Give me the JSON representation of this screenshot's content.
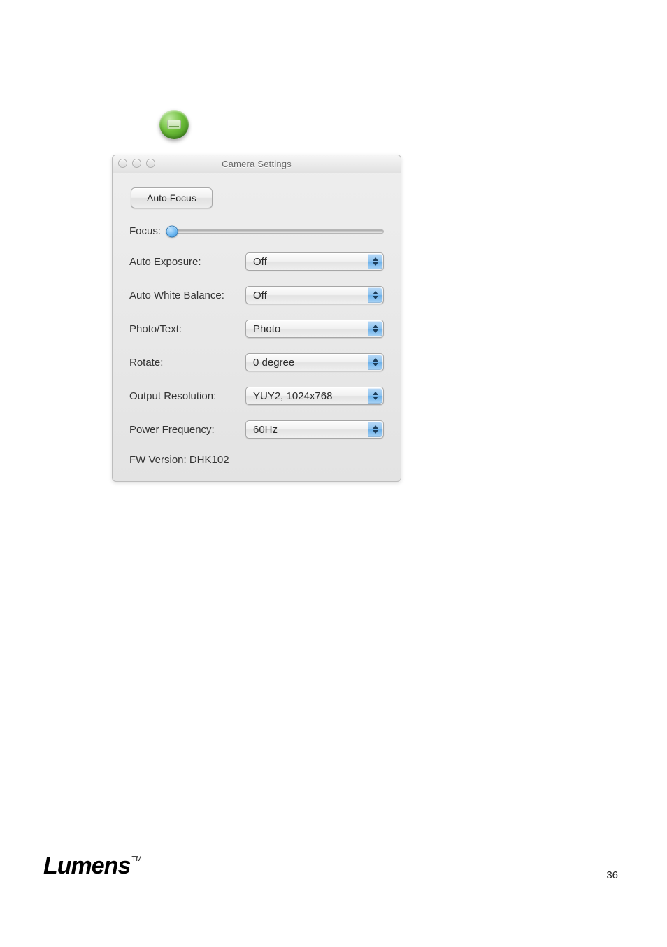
{
  "window": {
    "title": "Camera Settings"
  },
  "buttons": {
    "auto_focus": "Auto Focus"
  },
  "labels": {
    "focus": "Focus:",
    "auto_exposure": "Auto Exposure:",
    "auto_white_balance": "Auto White Balance:",
    "photo_text": "Photo/Text:",
    "rotate": "Rotate:",
    "output_resolution": "Output Resolution:",
    "power_frequency": "Power Frequency:",
    "fw_version": "FW Version: DHK102"
  },
  "values": {
    "auto_exposure": "Off",
    "auto_white_balance": "Off",
    "photo_text": "Photo",
    "rotate": "0 degree",
    "output_resolution": "YUY2, 1024x768",
    "power_frequency": "60Hz"
  },
  "footer": {
    "brand": "Lumens",
    "tm": "TM",
    "page_number": "36"
  }
}
